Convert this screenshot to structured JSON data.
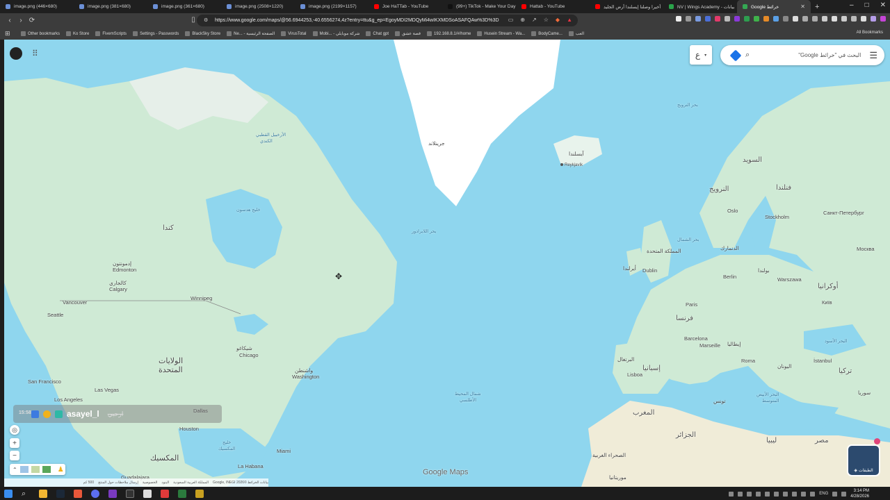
{
  "tabs": [
    {
      "title": "image.png (446×680)",
      "color": "#6b8fd6"
    },
    {
      "title": "image.png (381×680)",
      "color": "#6b8fd6"
    },
    {
      "title": "image.png (361×680)",
      "color": "#6b8fd6"
    },
    {
      "title": "image.png (2508×1220)",
      "color": "#6b8fd6"
    },
    {
      "title": "image.png (2199×1157)",
      "color": "#6b8fd6"
    },
    {
      "title": "Joe HaTTab - YouTube",
      "color": "#ff0000"
    },
    {
      "title": "(99+) TikTok - Make Your Day",
      "color": "#111111"
    },
    {
      "title": "Hattab - YouTube",
      "color": "#ff0000"
    },
    {
      "title": "أخيرا وصلنا إيسلندا أرض الجليد",
      "color": "#ff0000"
    },
    {
      "title": "NV | Wings Academy - بيانات",
      "color": "#2aa34a"
    },
    {
      "title": "Google خرائط",
      "color": "#34a853",
      "active": true
    }
  ],
  "address_bar": {
    "url": "https://www.google.com/maps/@56.6944253,-40.6556274,4z?entry=ttu&g_ep=EgoyMDI2MDQyMi4wIKXMDSoASAFQAw%3D%3D"
  },
  "bookmarks": [
    {
      "label": "Other bookmarks"
    },
    {
      "label": "Ko Store"
    },
    {
      "label": "FivemScripts"
    },
    {
      "label": "Settings - Passwords"
    },
    {
      "label": "BlackSky Store"
    },
    {
      "label": "Ne... - الصفحة الرئيسية"
    },
    {
      "label": "VirusTotal"
    },
    {
      "label": "Mobi... - شركة موبايلي"
    },
    {
      "label": "Chat gpt"
    },
    {
      "label": "قصة عشق"
    },
    {
      "label": "192.168.8.1/#/home"
    },
    {
      "label": "Husein Stream - Wa..."
    },
    {
      "label": "BodyCame..."
    },
    {
      "label": "العب"
    }
  ],
  "all_bookmarks": "All Bookmarks",
  "search": {
    "placeholder": "البحث في \"خرائط Google\""
  },
  "lang_button": "ع",
  "map_labels": {
    "greenland": "جرينلاند",
    "iceland": "آيسلندا",
    "reykjavik": "Reykjavík",
    "canada": "كندا",
    "usa_line1": "الولايات",
    "usa_line2": "المتحدة",
    "mexico": "المكسيك",
    "hudson_bay": "خليج هدسون",
    "labrador_sea": "بحر اللابرادور",
    "north_atlantic_1": "شمال المحيط",
    "north_atlantic_2": "الأطلسي",
    "north_sea": "بحر الشمال",
    "norwegian_sea": "بحر النرويج",
    "arctic_archipelago_1": "الأرخبيل القطبي",
    "arctic_archipelago_2": "الكندي",
    "gulf_of_mexico_1": "خليج",
    "gulf_of_mexico_2": "المكسيك",
    "edmonton": "إدمونتون",
    "edmonton_en": "Edmonton",
    "calgary": "كالجاري",
    "calgary_en": "Calgary",
    "vancouver": "Vancouver",
    "seattle": "Seattle",
    "winnipeg": "Winnipeg",
    "chicago": "Chicago",
    "chicago_ar": "شيكاغو",
    "washington": "Washington",
    "washington_ar": "واشنطن",
    "san_francisco": "San Francisco",
    "los_angeles": "Los Angeles",
    "las_vegas": "Las Vegas",
    "dallas": "Dallas",
    "houston": "Houston",
    "miami": "Miami",
    "la_habana": "La Habana",
    "guadalajara": "Guadalajara",
    "uk": "المملكة المتحدة",
    "ireland": "أيرلندا",
    "dublin": "Dublin",
    "sweden": "السويد",
    "norway": "النرويج",
    "finland": "فنلندا",
    "oslo": "Oslo",
    "stockholm": "Stockholm",
    "st_petersburg": "Санкт-Петербург",
    "moscow": "Москва",
    "denmark": "الدنمارك",
    "berlin": "Berlin",
    "poland": "بولندا",
    "warszawa": "Warszawa",
    "paris": "Paris",
    "france": "فرنسا",
    "ukraine": "أوكرانيا",
    "kyiv": "Київ",
    "spain": "إسبانيا",
    "portugal": "البرتغال",
    "lisboa": "Lisboa",
    "barcelona": "Barcelona",
    "marseille": "Marseille",
    "italy": "إيطاليا",
    "roma": "Roma",
    "greece": "اليونان",
    "turkey": "تركيا",
    "istanbul": "İstanbul",
    "black_sea": "البحر الأسود",
    "mediterranean_1": "البحر الأبيض",
    "mediterranean_2": "المتوسط",
    "morocco": "المغرب",
    "algeria": "الجزائر",
    "tunisia": "تونس",
    "libya": "ليبيا",
    "egypt": "مصر",
    "syria": "سوريا",
    "western_sahara": "الصحراء الغربية",
    "mauritania": "موريتانيا"
  },
  "overlay": {
    "name": "asayel_l",
    "strike": "ارحبي",
    "time": "15:58"
  },
  "layers_label": "الطبقات",
  "brand": "Google Maps",
  "attribution": [
    "بيانات الخرائط ©2026 Google, INEGI",
    "المملكة العربية السعودية",
    "البنود",
    "الخصوصية",
    "إرسال ملاحظات حول المنتج",
    "500 كم"
  ],
  "clock": {
    "time": "3:14 PM",
    "date": "4/28/2026",
    "lang": "ENG"
  },
  "colors": {
    "water": "#8fd6ee",
    "land": "#cfead5",
    "ice": "#ffffff",
    "accent": "#1a73e8"
  }
}
